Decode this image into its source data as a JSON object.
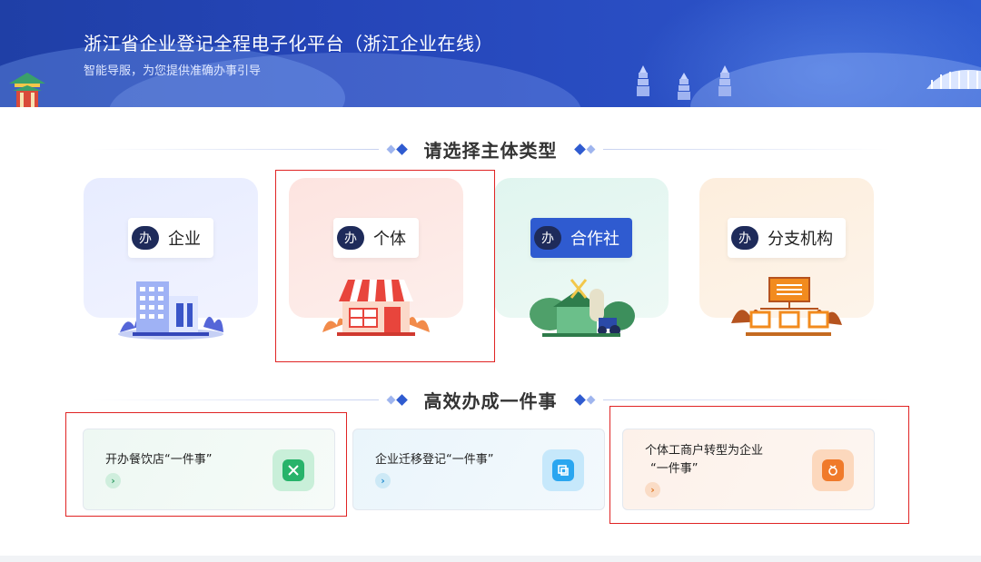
{
  "banner": {
    "title": "浙江省企业登记全程电子化平台（浙江企业在线）",
    "subtitle": "智能导服，为您提供准确办事引导"
  },
  "entity_section": {
    "heading": "请选择主体类型",
    "badge": "办",
    "cards": [
      {
        "label": "企业",
        "illustration": "office-building-icon",
        "selected": false
      },
      {
        "label": "个体",
        "illustration": "storefront-icon",
        "selected": true
      },
      {
        "label": "合作社",
        "illustration": "farm-tractor-icon",
        "selected": false
      },
      {
        "label": "分支机构",
        "illustration": "org-chart-icon",
        "selected": false
      }
    ]
  },
  "task_section": {
    "heading": "高效办成一件事",
    "tasks": [
      {
        "label": "开办餐饮店“一件事”",
        "icon": "restaurant-utensils-icon",
        "selected": true
      },
      {
        "label": "企业迁移登记“一件事”",
        "icon": "transfer-copy-icon",
        "selected": false
      },
      {
        "label": "个体工商户转型为企业",
        "label2": "“一件事”",
        "icon": "upgrade-badge-icon",
        "selected": true
      }
    ],
    "arrow_glyph": "›"
  },
  "colors": {
    "banner": "#2545b8",
    "accent": "#2f5bd0",
    "selection": "#e02424",
    "badge_bg": "#1e2b5a"
  }
}
